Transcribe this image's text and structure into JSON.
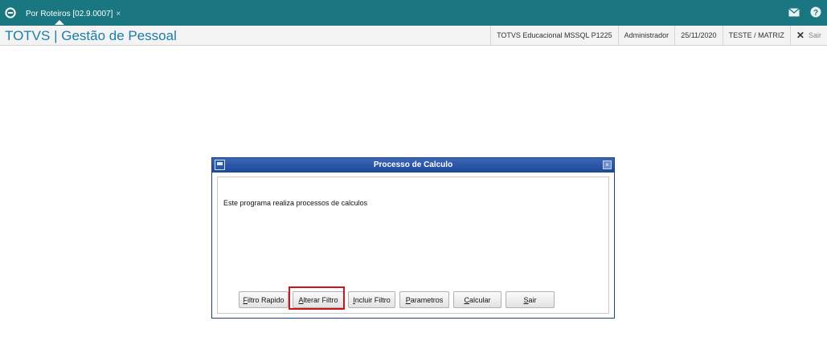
{
  "topbar": {
    "tab_label": "Por Roteiros [02.9.0007]",
    "tab_close": "×",
    "icons": [
      "totvs-logo-icon",
      "mail-icon",
      "help-icon"
    ]
  },
  "header": {
    "app_title": "TOTVS | Gestão de Pessoal",
    "environment": "TOTVS Educacional MSSQL P1225",
    "user": "Administrador",
    "date": "25/11/2020",
    "company": "TESTE / MATRIZ",
    "exit_label": "Sair"
  },
  "dialog": {
    "title": "Processo de Calculo",
    "message": "Este programa realiza processos de calculos",
    "buttons": [
      {
        "label": "Filtro Rapido",
        "mnemonic_index": 0
      },
      {
        "label": "Alterar Filtro",
        "mnemonic_index": 0
      },
      {
        "label": "Incluir Filtro",
        "mnemonic_index": 0
      },
      {
        "label": "Parametros",
        "mnemonic_index": 0
      },
      {
        "label": "Calcular",
        "mnemonic_index": 0
      },
      {
        "label": "Sair",
        "mnemonic_index": 0
      }
    ],
    "highlighted_button": "Alterar Filtro"
  },
  "colors": {
    "topbar": "#1a7680",
    "title_text": "#1a7ea8",
    "dialog_title": "#2a55a4",
    "highlight": "#d0141b"
  }
}
